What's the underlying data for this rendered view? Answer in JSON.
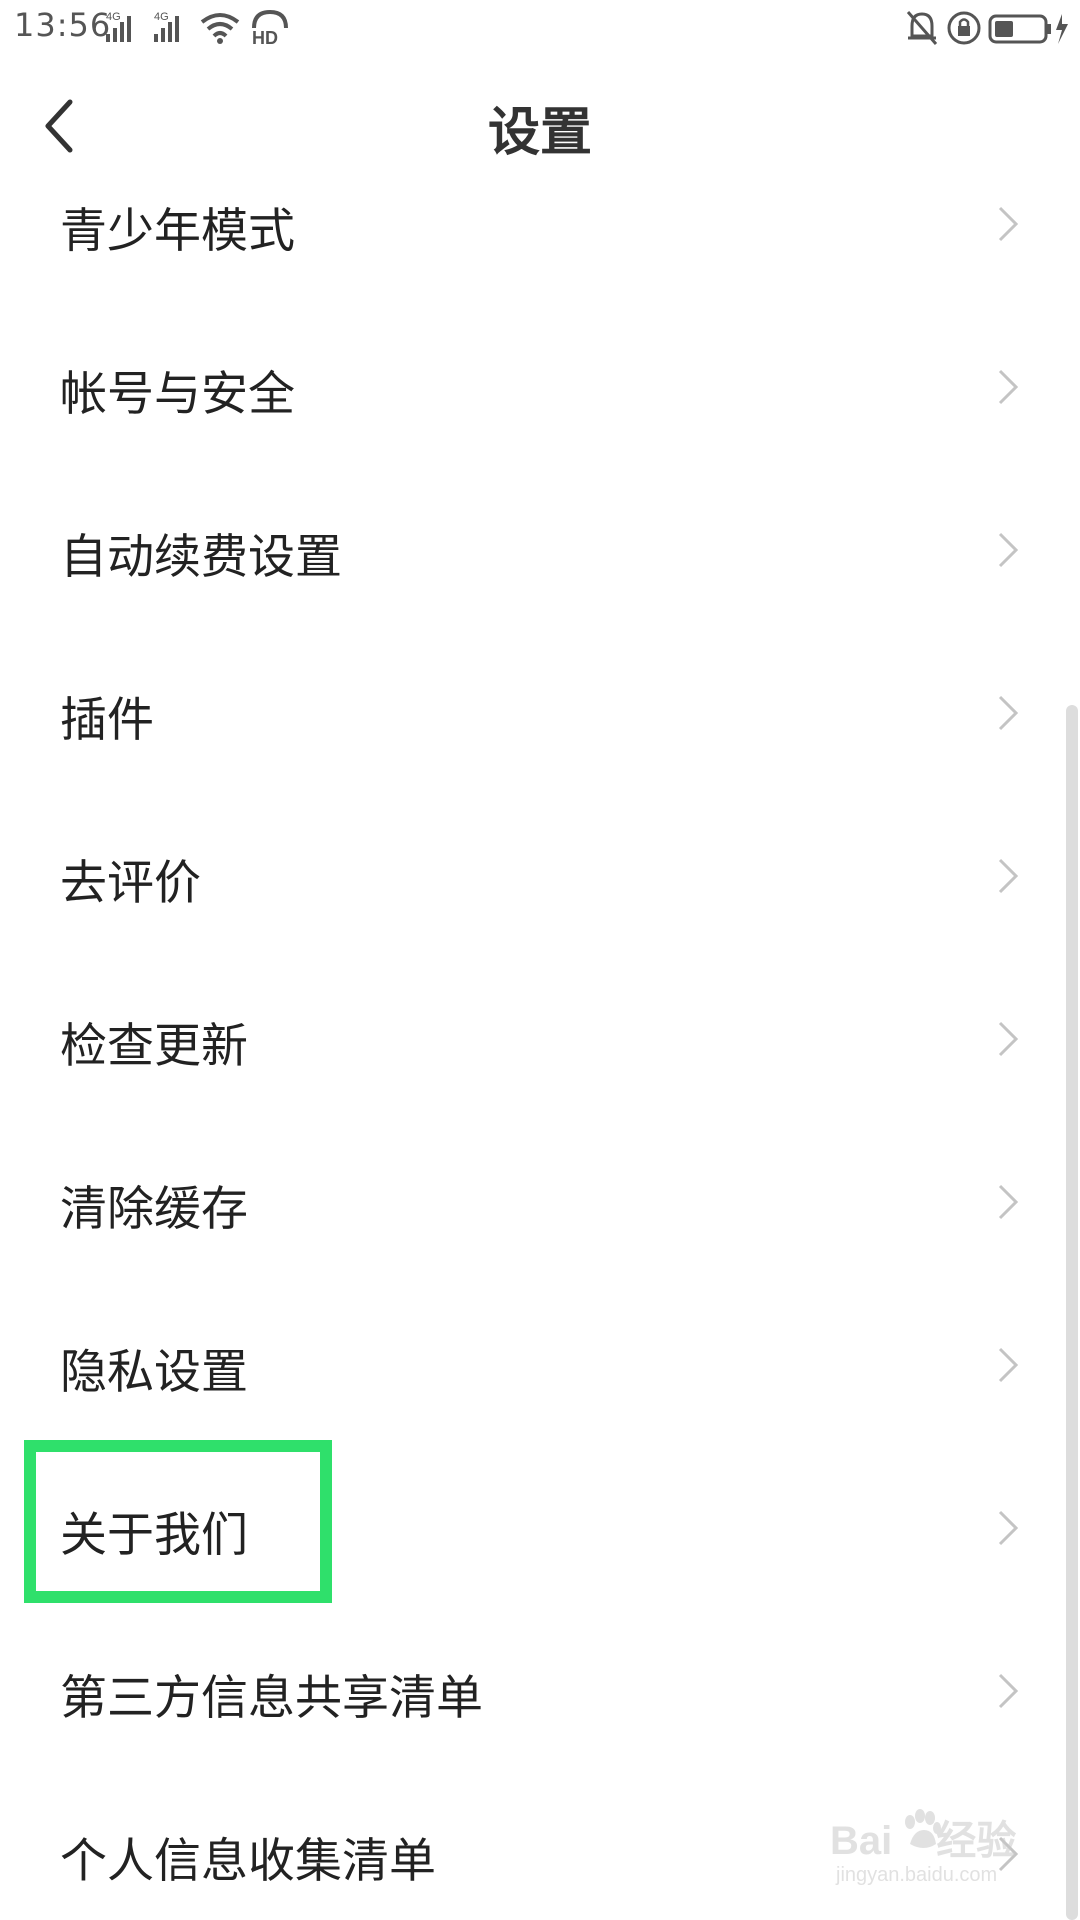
{
  "status_bar": {
    "time": "13:56",
    "signal1_label": "4G",
    "signal2_label": "4G",
    "hd_label": "HD",
    "icons": [
      "signal-4g-icon",
      "signal-4g-icon",
      "wifi-icon",
      "hd-voice-icon",
      "mute-icon",
      "rotation-lock-icon",
      "battery-charging-icon"
    ]
  },
  "header": {
    "title": "设置",
    "back_icon": "chevron-left-icon"
  },
  "settings_list": [
    {
      "label": "青少年模式"
    },
    {
      "label": "帐号与安全"
    },
    {
      "label": "自动续费设置"
    },
    {
      "label": "插件"
    },
    {
      "label": "去评价"
    },
    {
      "label": "检查更新"
    },
    {
      "label": "清除缓存"
    },
    {
      "label": "隐私设置"
    },
    {
      "label": "关于我们"
    },
    {
      "label": "第三方信息共享清单"
    },
    {
      "label": "个人信息收集清单"
    }
  ],
  "highlighted_item": "关于我们",
  "highlight_color": "#2fe06b",
  "watermark": {
    "brand": "Bai",
    "brand_suffix": "经验",
    "url": "jingyan.baidu.com"
  }
}
